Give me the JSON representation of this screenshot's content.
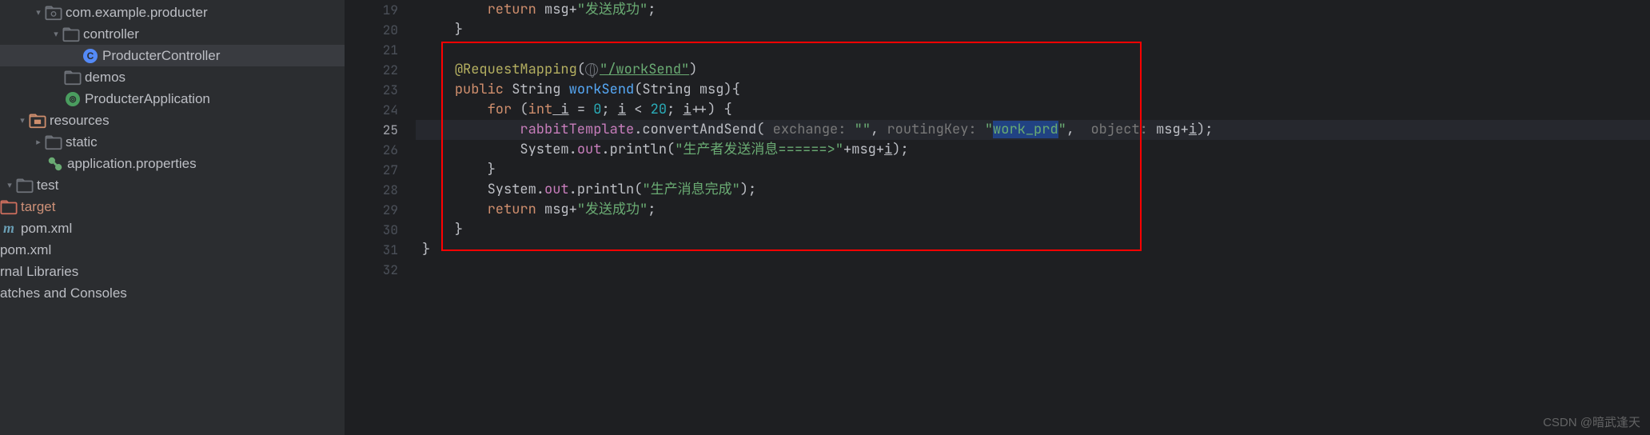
{
  "tree": {
    "package": "com.example.producter",
    "controller": "controller",
    "productercontroller": "ProducterController",
    "demos": "demos",
    "producterapp": "ProducterApplication",
    "resources": "resources",
    "static": "static",
    "appprops": "application.properties",
    "test": "test",
    "target": "target",
    "pom1": "pom.xml",
    "pom2": "pom.xml",
    "libs": "rnal Libraries",
    "scratches": "atches and Consoles"
  },
  "lines": [
    "19",
    "20",
    "21",
    "22",
    "23",
    "24",
    "25",
    "26",
    "27",
    "28",
    "29",
    "30",
    "31",
    "32"
  ],
  "code": {
    "l19_return": "return",
    "l19_msg": " msg",
    "l19_plus": "+",
    "l19_str": "\"发送成功\"",
    "l19_semi": ";",
    "l20_brace": "    }",
    "l22_ann": "@RequestMapping",
    "l22_paren1": "(",
    "l22_url": "\"/workSend\"",
    "l22_paren2": ")",
    "l23_public": "public",
    "l23_string": " String ",
    "l23_method": "workSend",
    "l23_params": "(String msg){",
    "l24_for": "for",
    "l24_paren": " (",
    "l24_int": "int",
    "l24_i1": " i",
    "l24_eq": " = ",
    "l24_zero": "0",
    "l24_semi1": "; ",
    "l24_i2": "i",
    "l24_lt": " < ",
    "l24_twenty": "20",
    "l24_semi2": "; ",
    "l24_i3": "i",
    "l24_inc": "++) {",
    "l25_rabbit": "rabbitTemplate",
    "l25_dot": ".convertAndSend(",
    "l25_hint1": " exchange: ",
    "l25_empty": "\"\"",
    "l25_comma1": ", ",
    "l25_hint2": "routingKey: ",
    "l25_work": "\"work_prd\"",
    "l25_comma2": ", ",
    "l25_hint3": " object: ",
    "l25_msg": "msg+",
    "l25_i": "i",
    "l25_end": ");",
    "l26_sys": "System.",
    "l26_out": "out",
    "l26_println": ".println(",
    "l26_str": "\"生产者发送消息======>\"",
    "l26_plus": "+msg+",
    "l26_i": "i",
    "l26_end": ");",
    "l27_brace": "        }",
    "l28_sys": "System.",
    "l28_out": "out",
    "l28_println": ".println(",
    "l28_str": "\"生产消息完成\"",
    "l28_end": ");",
    "l29_return": "return",
    "l29_msg": " msg+",
    "l29_str": "\"发送成功\"",
    "l29_semi": ";",
    "l30_brace": "    }",
    "l31_brace": "}"
  },
  "watermark": "CSDN @暗武逢天"
}
